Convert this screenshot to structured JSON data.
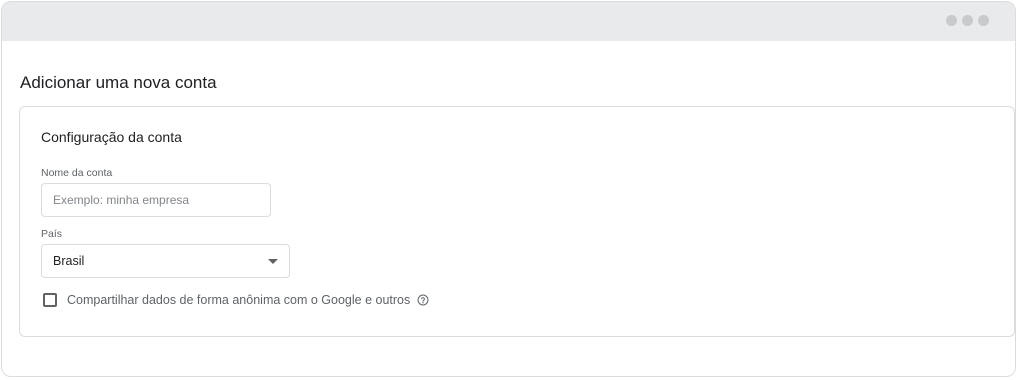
{
  "page": {
    "title": "Adicionar uma nova conta"
  },
  "card": {
    "title": "Configuração da conta",
    "account_name": {
      "label": "Nome da conta",
      "value": "",
      "placeholder": "Exemplo: minha empresa"
    },
    "country": {
      "label": "País",
      "selected": "Brasil"
    },
    "share_data": {
      "label": "Compartilhar dados de forma anônima com o Google e outros",
      "checked": false
    }
  },
  "icons": {
    "window_controls": "ellipsis-dots",
    "country_dropdown": "caret-down-icon",
    "share_help": "help-circle-icon"
  },
  "colors": {
    "titlebar": "#e8eaeb",
    "border": "#dadce0",
    "text_primary": "#202124",
    "text_secondary": "#5f6368"
  }
}
